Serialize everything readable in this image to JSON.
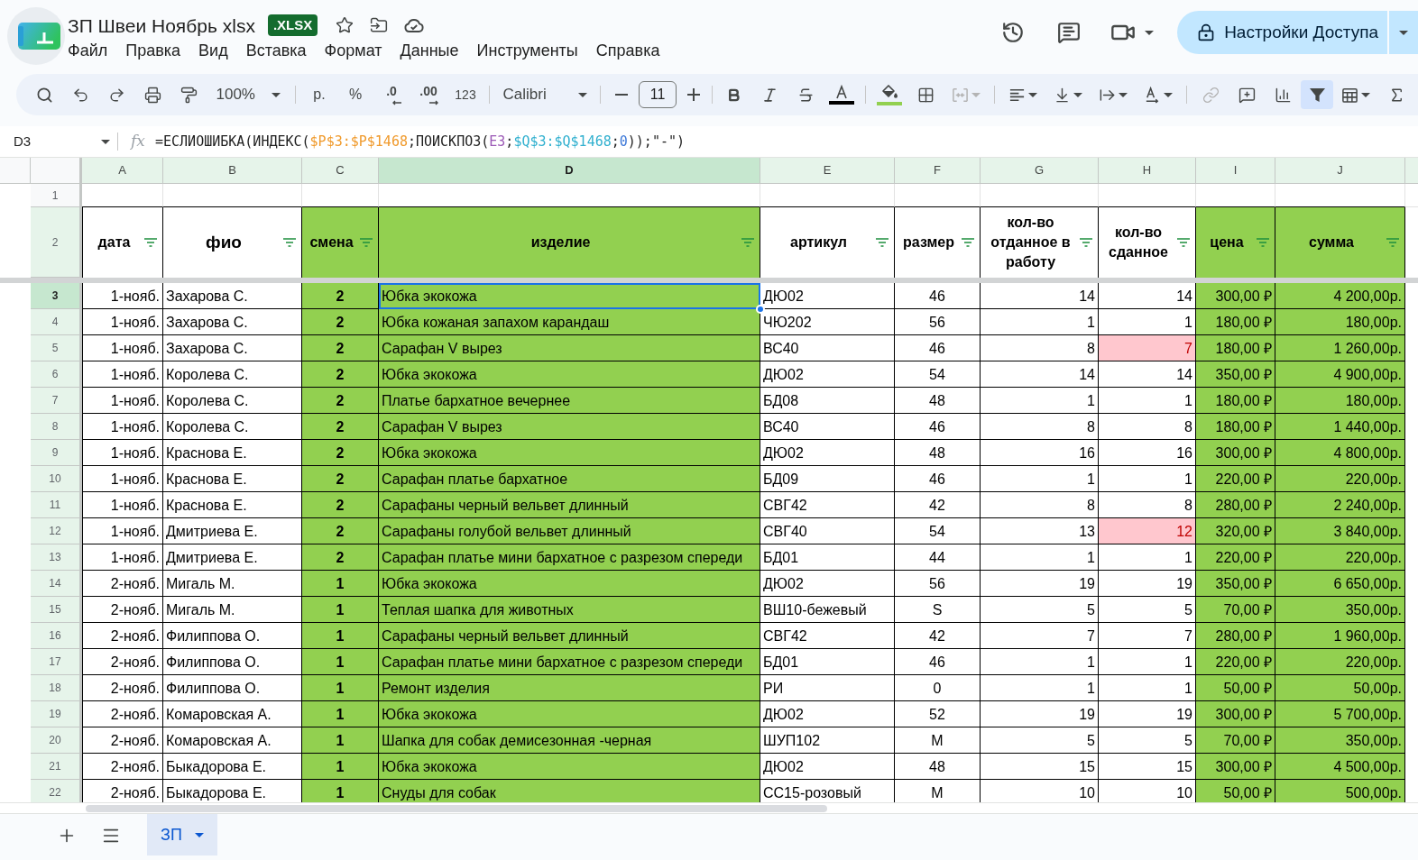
{
  "document": {
    "title": "ЗП Швеи Ноябрь xlsx",
    "format_badge": ".XLSX"
  },
  "menu": [
    "Файл",
    "Правка",
    "Вид",
    "Вставка",
    "Формат",
    "Данные",
    "Инструменты",
    "Справка"
  ],
  "share_button": {
    "label": "Настройки Доступа"
  },
  "toolbar": {
    "zoom": "100%",
    "currency": "р.",
    "percent": "%",
    "decrease_decimals": ".0",
    "increase_decimals": ".00",
    "more_formats": "123",
    "font": "Calibri",
    "font_size": "11",
    "merge_disabled": true,
    "link_disabled": true,
    "filter_on": true
  },
  "formula_bar": {
    "cell": "D3",
    "fx": "fx",
    "formula": [
      {
        "text": "=ЕСЛИОШИБКА(ИНДЕКС(",
        "color": "#1f1f1f"
      },
      {
        "text": "$P$3:$P$1468",
        "color": "#f09a2c"
      },
      {
        "text": ";ПОИСКПОЗ(",
        "color": "#1f1f1f"
      },
      {
        "text": "E3",
        "color": "#9b59b6"
      },
      {
        "text": ";",
        "color": "#1f1f1f"
      },
      {
        "text": "$Q$3:$Q$1468",
        "color": "#31b0cf"
      },
      {
        "text": ";",
        "color": "#1f1f1f"
      },
      {
        "text": "0",
        "color": "#3c78d8"
      },
      {
        "text": "));\"-\")",
        "color": "#1f1f1f"
      }
    ]
  },
  "column_headers": [
    {
      "label": "A",
      "selected": false
    },
    {
      "label": "B",
      "selected": false
    },
    {
      "label": "C",
      "selected": false
    },
    {
      "label": "D",
      "selected": true
    },
    {
      "label": "E",
      "selected": false
    },
    {
      "label": "F",
      "selected": false
    },
    {
      "label": "G",
      "selected": false
    },
    {
      "label": "H",
      "selected": false
    },
    {
      "label": "I",
      "selected": false
    },
    {
      "label": "J",
      "selected": false
    }
  ],
  "row_headers": [
    {
      "label": "1",
      "selected": false,
      "highlighted": false
    },
    {
      "label": "2",
      "selected": false,
      "highlighted": true
    },
    {
      "label": "3",
      "selected": true,
      "highlighted": true
    },
    {
      "label": "4",
      "selected": false,
      "highlighted": true
    },
    {
      "label": "5",
      "selected": false,
      "highlighted": true
    },
    {
      "label": "6",
      "selected": false,
      "highlighted": true
    },
    {
      "label": "7",
      "selected": false,
      "highlighted": true
    },
    {
      "label": "8",
      "selected": false,
      "highlighted": true
    },
    {
      "label": "9",
      "selected": false,
      "highlighted": true
    },
    {
      "label": "10",
      "selected": false,
      "highlighted": true
    },
    {
      "label": "11",
      "selected": false,
      "highlighted": true
    },
    {
      "label": "12",
      "selected": false,
      "highlighted": true
    },
    {
      "label": "13",
      "selected": false,
      "highlighted": true
    },
    {
      "label": "14",
      "selected": false,
      "highlighted": true
    },
    {
      "label": "15",
      "selected": false,
      "highlighted": true
    },
    {
      "label": "16",
      "selected": false,
      "highlighted": true
    },
    {
      "label": "17",
      "selected": false,
      "highlighted": true
    },
    {
      "label": "18",
      "selected": false,
      "highlighted": true
    },
    {
      "label": "19",
      "selected": false,
      "highlighted": true
    },
    {
      "label": "20",
      "selected": false,
      "highlighted": true
    },
    {
      "label": "21",
      "selected": false,
      "highlighted": true
    },
    {
      "label": "22",
      "selected": false,
      "highlighted": true
    }
  ],
  "table": {
    "columns": [
      {
        "name": "дата",
        "color": "#ffffff"
      },
      {
        "name": "фио",
        "color": "#ffffff"
      },
      {
        "name": "смена",
        "color": "#92d050"
      },
      {
        "name": "изделие",
        "color": "#92d050"
      },
      {
        "name": "артикул",
        "color": "#ffffff"
      },
      {
        "name": "размер",
        "color": "#ffffff"
      },
      {
        "name": "кол-во отданное в работу",
        "color": "#ffffff"
      },
      {
        "name": "кол-во сданное",
        "color": "#ffffff"
      },
      {
        "name": "цена",
        "color": "#92d050"
      },
      {
        "name": "сумма",
        "color": "#92d050"
      }
    ],
    "rows": [
      {
        "cells": [
          "1-нояб.",
          "Захарова С.",
          "2",
          "Юбка экокожа",
          "ДЮ02",
          "46",
          "14",
          "14",
          "300,00 ₽",
          "4 200,00р."
        ],
        "returned_flagged": false,
        "item_selected": true
      },
      {
        "cells": [
          "1-нояб.",
          "Захарова С.",
          "2",
          "Юбка кожаная запахом карандаш",
          "ЧЮ202",
          "56",
          "1",
          "1",
          "180,00 ₽",
          "180,00р."
        ],
        "returned_flagged": false,
        "item_selected": false
      },
      {
        "cells": [
          "1-нояб.",
          "Захарова С.",
          "2",
          "Сарафан V вырез",
          "ВС40",
          "46",
          "8",
          "7",
          "180,00 ₽",
          "1 260,00р."
        ],
        "returned_flagged": true,
        "item_selected": false
      },
      {
        "cells": [
          "1-нояб.",
          "Королева С.",
          "2",
          "Юбка экокожа",
          "ДЮ02",
          "54",
          "14",
          "14",
          "350,00 ₽",
          "4 900,00р."
        ],
        "returned_flagged": false,
        "item_selected": false
      },
      {
        "cells": [
          "1-нояб.",
          "Королева С.",
          "2",
          "Платье бархатное вечернее",
          "БД08",
          "48",
          "1",
          "1",
          "180,00 ₽",
          "180,00р."
        ],
        "returned_flagged": false,
        "item_selected": false
      },
      {
        "cells": [
          "1-нояб.",
          "Королева С.",
          "2",
          "Сарафан V вырез",
          "ВС40",
          "46",
          "8",
          "8",
          "180,00 ₽",
          "1 440,00р."
        ],
        "returned_flagged": false,
        "item_selected": false
      },
      {
        "cells": [
          "1-нояб.",
          "Краснова Е.",
          "2",
          "Юбка экокожа",
          "ДЮ02",
          "48",
          "16",
          "16",
          "300,00 ₽",
          "4 800,00р."
        ],
        "returned_flagged": false,
        "item_selected": false
      },
      {
        "cells": [
          "1-нояб.",
          "Краснова Е.",
          "2",
          "Сарафан платье бархатное",
          "БД09",
          "46",
          "1",
          "1",
          "220,00 ₽",
          "220,00р."
        ],
        "returned_flagged": false,
        "item_selected": false
      },
      {
        "cells": [
          "1-нояб.",
          "Краснова Е.",
          "2",
          "Сарафаны черный вельвет длинный",
          "СВГ42",
          "42",
          "8",
          "8",
          "280,00 ₽",
          "2 240,00р."
        ],
        "returned_flagged": false,
        "item_selected": false
      },
      {
        "cells": [
          "1-нояб.",
          "Дмитриева Е.",
          "2",
          "Сарафаны голубой вельвет длинный",
          "СВГ40",
          "54",
          "13",
          "12",
          "320,00 ₽",
          "3 840,00р."
        ],
        "returned_flagged": true,
        "item_selected": false
      },
      {
        "cells": [
          "1-нояб.",
          "Дмитриева Е.",
          "2",
          "Сарафан платье мини бархатное с разрезом спереди",
          "БД01",
          "44",
          "1",
          "1",
          "220,00 ₽",
          "220,00р."
        ],
        "returned_flagged": false,
        "item_selected": false
      },
      {
        "cells": [
          "2-нояб.",
          "Мигаль М.",
          "1",
          "Юбка экокожа",
          "ДЮ02",
          "56",
          "19",
          "19",
          "350,00 ₽",
          "6 650,00р."
        ],
        "returned_flagged": false,
        "item_selected": false
      },
      {
        "cells": [
          "2-нояб.",
          "Мигаль М.",
          "1",
          "Теплая шапка для животных",
          "ВШ10-бежевый",
          "S",
          "5",
          "5",
          "70,00 ₽",
          "350,00р."
        ],
        "returned_flagged": false,
        "item_selected": false
      },
      {
        "cells": [
          "2-нояб.",
          "Филиппова О.",
          "1",
          "Сарафаны черный вельвет длинный",
          "СВГ42",
          "42",
          "7",
          "7",
          "280,00 ₽",
          "1 960,00р."
        ],
        "returned_flagged": false,
        "item_selected": false
      },
      {
        "cells": [
          "2-нояб.",
          "Филиппова О.",
          "1",
          "Сарафан платье мини бархатное с разрезом спереди",
          "БД01",
          "46",
          "1",
          "1",
          "220,00 ₽",
          "220,00р."
        ],
        "returned_flagged": false,
        "item_selected": false
      },
      {
        "cells": [
          "2-нояб.",
          "Филиппова О.",
          "1",
          "Ремонт изделия",
          "РИ",
          "0",
          "1",
          "1",
          "50,00 ₽",
          "50,00р."
        ],
        "returned_flagged": false,
        "item_selected": false
      },
      {
        "cells": [
          "2-нояб.",
          "Комаровская А.",
          "1",
          "Юбка экокожа",
          "ДЮ02",
          "52",
          "19",
          "19",
          "300,00 ₽",
          "5 700,00р."
        ],
        "returned_flagged": false,
        "item_selected": false
      },
      {
        "cells": [
          "2-нояб.",
          "Комаровская А.",
          "1",
          "Шапка для собак демисезонная -черная",
          "ШУП102",
          "M",
          "5",
          "5",
          "70,00 ₽",
          "350,00р."
        ],
        "returned_flagged": false,
        "item_selected": false
      },
      {
        "cells": [
          "2-нояб.",
          "Быкадорова Е.",
          "1",
          "Юбка экокожа",
          "ДЮ02",
          "48",
          "15",
          "15",
          "300,00 ₽",
          "4 500,00р."
        ],
        "returned_flagged": false,
        "item_selected": false
      },
      {
        "cells": [
          "2-нояб.",
          "Быкадорова Е.",
          "1",
          "Снуды для собак",
          "СС15-розовый",
          "M",
          "10",
          "10",
          "50,00 ₽",
          "500,00р."
        ],
        "returned_flagged": false,
        "item_selected": false
      }
    ]
  },
  "sheets": [
    {
      "label": "ЗП",
      "selected": true
    }
  ]
}
